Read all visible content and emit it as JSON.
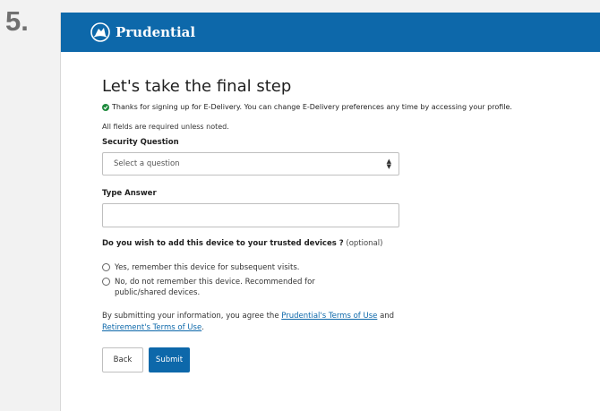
{
  "step": {
    "number": "5."
  },
  "header": {
    "brand": "Prudential",
    "logo_icon": "rock-logo-icon"
  },
  "page": {
    "title": "Let's take the final step",
    "notice": "Thanks for signing up for E-Delivery. You can change E-Delivery preferences any time by accessing your profile.",
    "required_note": "All fields are required unless noted."
  },
  "security": {
    "label": "Security Question",
    "placeholder": "Select a question"
  },
  "answer": {
    "label": "Type Answer",
    "value": ""
  },
  "trusted": {
    "question": "Do you wish to add this device to your trusted devices ?",
    "optional": "(optional)",
    "options": [
      "Yes, remember this device for subsequent visits.",
      "No, do not remember this device. Recommended for public/shared devices."
    ]
  },
  "terms": {
    "prefix": "By submitting your information, you agree the",
    "link1": "Prudential's Terms of Use",
    "middle": "and",
    "link2": "Retirement's Terms of Use",
    "suffix": "."
  },
  "actions": {
    "back": "Back",
    "submit": "Submit"
  },
  "colors": {
    "brand": "#0d68aa",
    "success": "#1e8a3c"
  }
}
